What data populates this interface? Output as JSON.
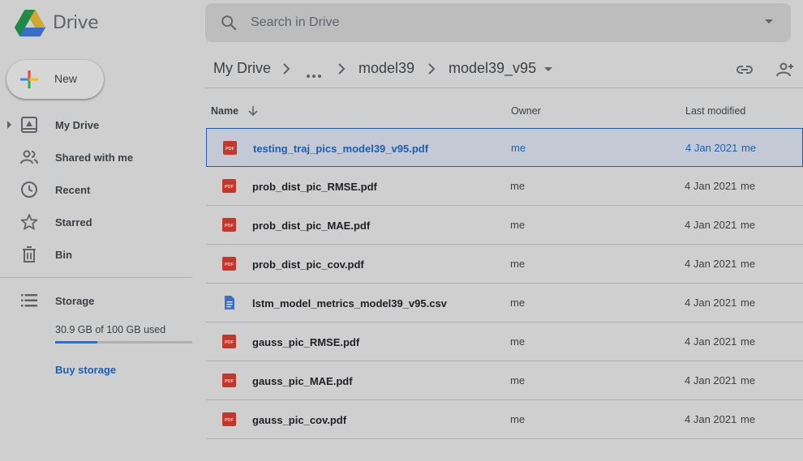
{
  "app": {
    "title": "Drive"
  },
  "search": {
    "placeholder": "Search in Drive",
    "value": ""
  },
  "sidebar": {
    "new_label": "New",
    "items": [
      {
        "label": "My Drive",
        "icon": "my-drive-icon"
      },
      {
        "label": "Shared with me",
        "icon": "shared-icon"
      },
      {
        "label": "Recent",
        "icon": "clock-icon"
      },
      {
        "label": "Starred",
        "icon": "star-icon"
      },
      {
        "label": "Bin",
        "icon": "trash-icon"
      }
    ],
    "storage": {
      "label": "Storage",
      "used_text": "30.9 GB of 100 GB used",
      "used_fraction": 0.309,
      "buy_label": "Buy storage"
    }
  },
  "breadcrumb": {
    "root": "My Drive",
    "parent": "model39",
    "current": "model39_v95"
  },
  "table": {
    "headers": {
      "name": "Name",
      "owner": "Owner",
      "modified": "Last modified"
    },
    "rows": [
      {
        "name": "testing_traj_pics_model39_v95.pdf",
        "type": "pdf",
        "owner": "me",
        "modified": "4 Jan 2021",
        "modified_by": "me",
        "selected": true
      },
      {
        "name": "prob_dist_pic_RMSE.pdf",
        "type": "pdf",
        "owner": "me",
        "modified": "4 Jan 2021",
        "modified_by": "me"
      },
      {
        "name": "prob_dist_pic_MAE.pdf",
        "type": "pdf",
        "owner": "me",
        "modified": "4 Jan 2021",
        "modified_by": "me"
      },
      {
        "name": "prob_dist_pic_cov.pdf",
        "type": "pdf",
        "owner": "me",
        "modified": "4 Jan 2021",
        "modified_by": "me"
      },
      {
        "name": "lstm_model_metrics_model39_v95.csv",
        "type": "doc",
        "owner": "me",
        "modified": "4 Jan 2021",
        "modified_by": "me"
      },
      {
        "name": "gauss_pic_RMSE.pdf",
        "type": "pdf",
        "owner": "me",
        "modified": "4 Jan 2021",
        "modified_by": "me"
      },
      {
        "name": "gauss_pic_MAE.pdf",
        "type": "pdf",
        "owner": "me",
        "modified": "4 Jan 2021",
        "modified_by": "me"
      },
      {
        "name": "gauss_pic_cov.pdf",
        "type": "pdf",
        "owner": "me",
        "modified": "4 Jan 2021",
        "modified_by": "me"
      }
    ]
  },
  "colors": {
    "accent": "#1a73e8",
    "link": "#1a5fb4",
    "pdf": "#d93025",
    "doc": "#4285f4"
  }
}
